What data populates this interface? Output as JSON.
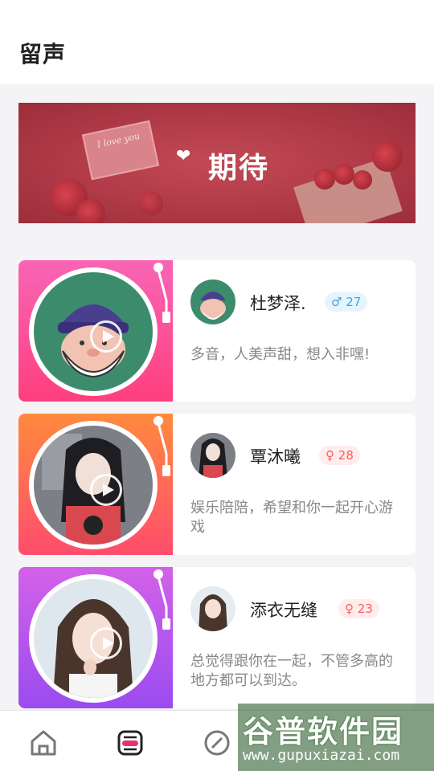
{
  "header": {
    "title": "留声"
  },
  "banner": {
    "text": "期待",
    "letter_text": "I love you"
  },
  "cards": [
    {
      "name": "杜梦泽.",
      "gender": "male",
      "gender_symbol": "♂",
      "age": "27",
      "description": "多音，人美声甜，想入非嘿!"
    },
    {
      "name": "覃沐曦",
      "gender": "female",
      "gender_symbol": "♀",
      "age": "28",
      "description": "娱乐陪陪，希望和你一起开心游戏"
    },
    {
      "name": "添衣无缝",
      "gender": "female",
      "gender_symbol": "♀",
      "age": "23",
      "description": "总觉得跟你在一起，不管多高的地方都可以到达。"
    }
  ],
  "tabbar": {
    "icons": [
      "home-icon",
      "voice-icon",
      "discover-icon",
      "message-icon",
      "profile-icon"
    ],
    "active_color": "#e8336a"
  },
  "watermark": {
    "cn": "谷普软件园",
    "url": "www.gupuxiazai.com"
  },
  "colors": {
    "male": "#3aa7e6",
    "female": "#ff5a5a"
  }
}
